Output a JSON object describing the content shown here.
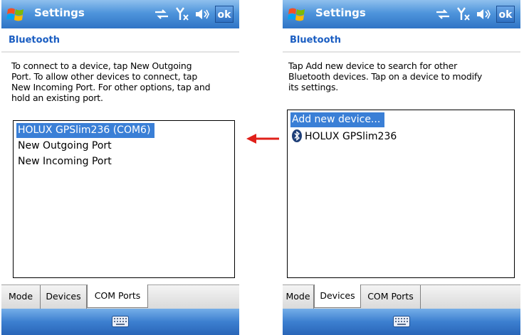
{
  "left_screen": {
    "title": "Settings",
    "ok_label": "ok",
    "section_title": "Bluetooth",
    "instructions": [
      "To connect to a device, tap New Outgoing",
      "Port. To allow other devices to connect, tap",
      "New Incoming Port. For other options, tap and",
      "hold an existing port."
    ],
    "list_items": [
      {
        "label": "HOLUX GPSlim236 (COM6)",
        "selected": true
      },
      {
        "label": "New Outgoing Port",
        "selected": false
      },
      {
        "label": "New Incoming Port",
        "selected": false
      }
    ],
    "tabs": [
      {
        "label": "Mode",
        "active": false
      },
      {
        "label": "Devices",
        "active": false
      },
      {
        "label": "COM Ports",
        "active": true
      }
    ]
  },
  "right_screen": {
    "title": "Settings",
    "ok_label": "ok",
    "section_title": "Bluetooth",
    "instructions": [
      "Tap Add new device to search for other",
      "Bluetooth devices. Tap on a device to modify",
      "its settings."
    ],
    "list_items": [
      {
        "label": "Add new device...",
        "selected": true,
        "icon": null
      },
      {
        "label": "HOLUX GPSlim236",
        "selected": false,
        "icon": "bluetooth-icon"
      }
    ],
    "tabs": [
      {
        "label": "Mode",
        "active": false
      },
      {
        "label": "Devices",
        "active": true
      },
      {
        "label": "COM Ports",
        "active": false
      }
    ]
  },
  "status_icons": [
    "connectivity-icon",
    "no-signal-icon",
    "volume-icon"
  ],
  "colors": {
    "title_bar": "#4f95dc",
    "section_title": "#1b5ec2",
    "selection": "#3a7fd6",
    "arrow": "#e0201a"
  }
}
